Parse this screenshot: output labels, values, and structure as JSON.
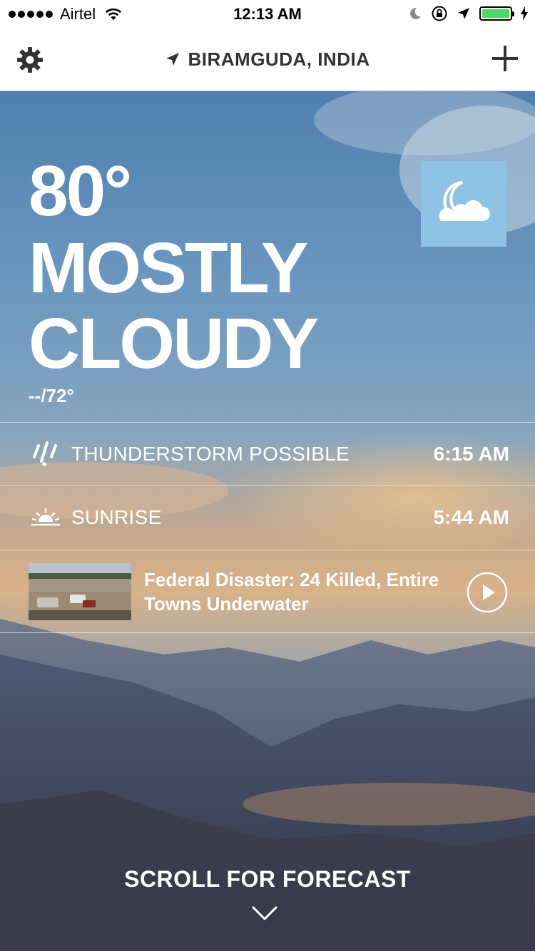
{
  "status_bar": {
    "carrier": "Airtel",
    "time": "12:13 AM"
  },
  "nav": {
    "location": "BIRAMGUDA, INDIA",
    "icons": [
      "gear-icon",
      "location-arrow-icon",
      "plus-icon"
    ]
  },
  "current": {
    "temperature": "80°",
    "condition": "MOSTLY CLOUDY",
    "hi_lo": "--/72°",
    "icon": "moon-cloud-icon",
    "icon_bg_color": "#8ec3e6"
  },
  "alerts": [
    {
      "icon": "rain-icon",
      "label": "THUNDERSTORM POSSIBLE",
      "time": "6:15 AM"
    },
    {
      "icon": "sunrise-icon",
      "label": "SUNRISE",
      "time": "5:44 AM"
    }
  ],
  "news": {
    "headline": "Federal Disaster: 24 Killed, Entire Towns Underwater",
    "icon": "play-icon"
  },
  "footer": {
    "scroll_label": "SCROLL FOR FORECAST",
    "icon": "chevron-down-icon"
  }
}
